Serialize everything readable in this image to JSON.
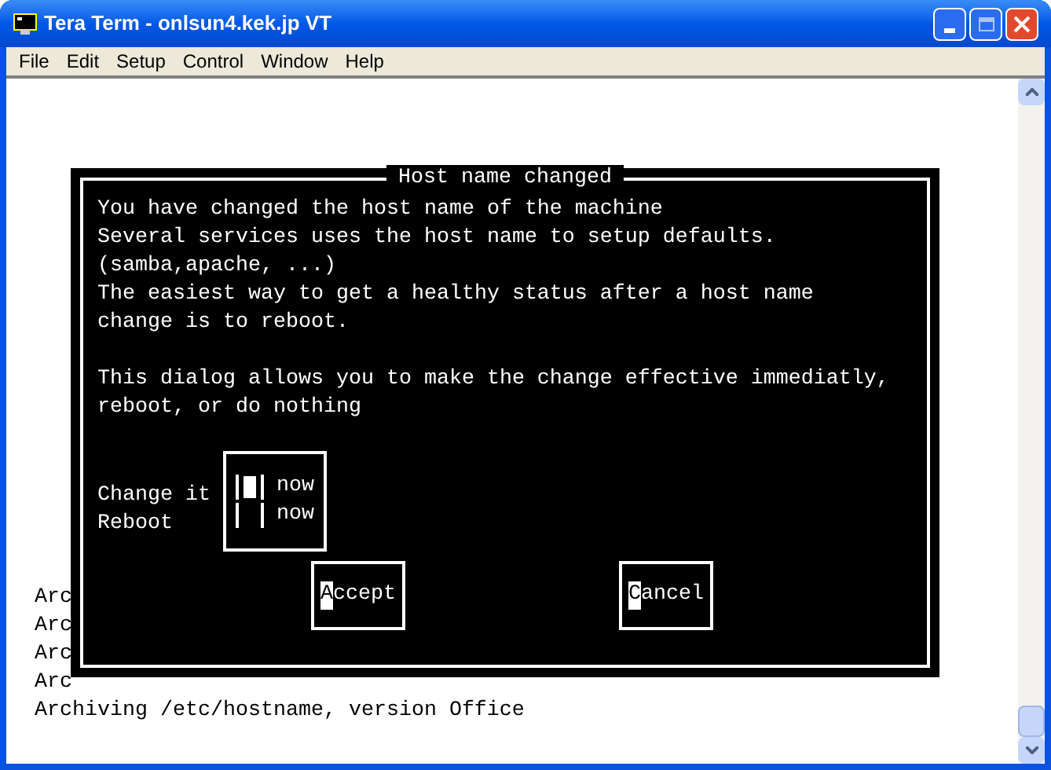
{
  "window": {
    "title": "Tera Term - onlsun4.kek.jp VT"
  },
  "menu": [
    "File",
    "Edit",
    "Setup",
    "Control",
    "Window",
    "Help"
  ],
  "terminal_lines": [
    "Arc",
    "Arc",
    "Arc",
    "Arc",
    "Archiving /etc/hostname, version Office"
  ],
  "dialog": {
    "title": "Host name changed",
    "paragraphs": [
      [
        "You have changed the host name of the machine",
        "Several services uses the host name to setup defaults.",
        "(samba,apache, ...)",
        "The easiest way to get a healthy status after a host name",
        "change is to reboot."
      ],
      [
        "This dialog allows you to make the change effective immediatly,",
        "reboot, or do nothing"
      ]
    ],
    "options": [
      {
        "label": "Change it",
        "box_label": "now",
        "checked": false,
        "focused": true
      },
      {
        "label": "Reboot",
        "box_label": "now",
        "checked": false,
        "focused": false
      }
    ],
    "buttons": [
      {
        "label": "Accept"
      },
      {
        "label": "Cancel"
      }
    ]
  }
}
